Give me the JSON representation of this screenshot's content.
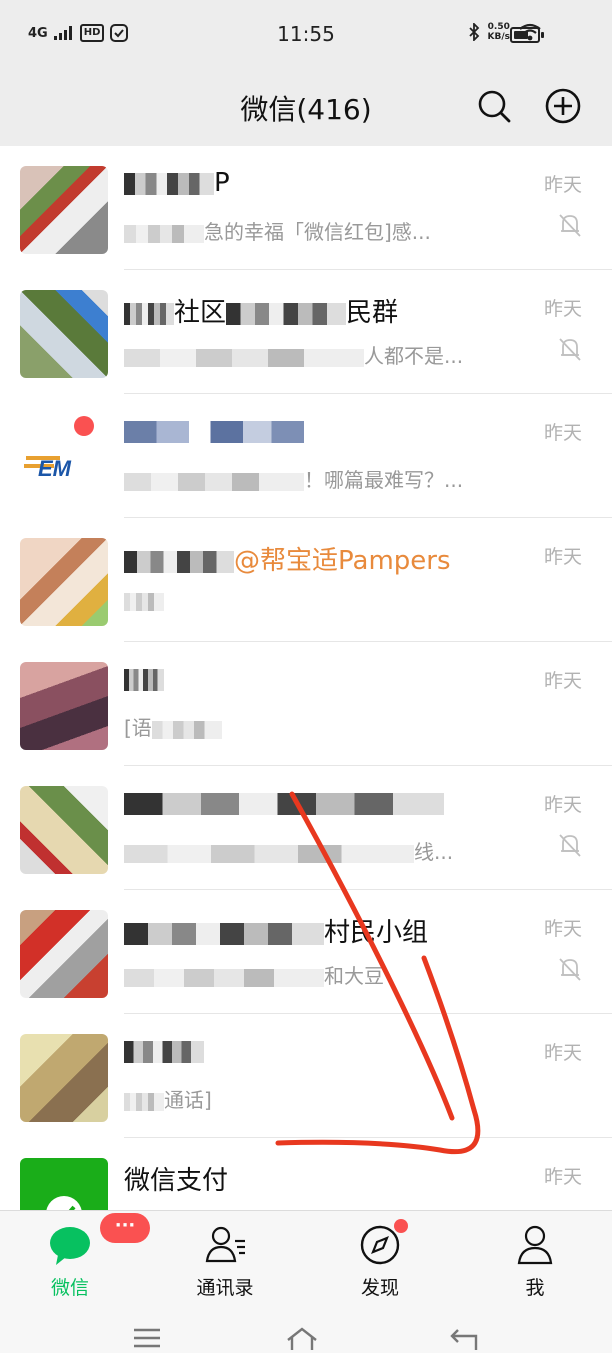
{
  "status_bar": {
    "network": "4G",
    "hd": "HD",
    "time": "11:55",
    "speed_value": "0.50",
    "speed_unit": "KB/s",
    "battery_level": 0.65
  },
  "header": {
    "title": "微信(416)"
  },
  "chats": [
    {
      "name": "P",
      "preview": "急的幸福「微信红包]感...",
      "time": "昨天",
      "muted": true
    },
    {
      "name_a": "社区",
      "name_b": "民群",
      "preview": "人都不是...",
      "time": "昨天",
      "muted": true
    },
    {
      "name": "",
      "preview": "！哪篇最难写？...",
      "time": "昨天",
      "muted": false
    },
    {
      "name": "",
      "preview": "@帮宝适Pampers",
      "time": "昨天",
      "muted": false
    },
    {
      "name": "",
      "preview": "[语",
      "time": "昨天",
      "muted": false
    },
    {
      "name": "",
      "preview": "线...",
      "time": "昨天",
      "muted": true
    },
    {
      "name": "村民小组",
      "preview": "和大豆",
      "time": "昨天",
      "muted": true
    },
    {
      "name": "",
      "preview": "通话]",
      "time": "昨天",
      "muted": false
    },
    {
      "name": "微信支付",
      "preview": "",
      "time": "昨天",
      "muted": false
    }
  ],
  "tabs": [
    {
      "label": "微信",
      "badge": "···",
      "active": true
    },
    {
      "label": "通讯录",
      "active": false
    },
    {
      "label": "发现",
      "dot": true,
      "active": false
    },
    {
      "label": "我",
      "active": false
    }
  ],
  "colors": {
    "accent": "#07c160",
    "badge": "#fa5151",
    "mention": "#e88a3c",
    "pay": "#576b95",
    "annotation": "#e8381f"
  }
}
